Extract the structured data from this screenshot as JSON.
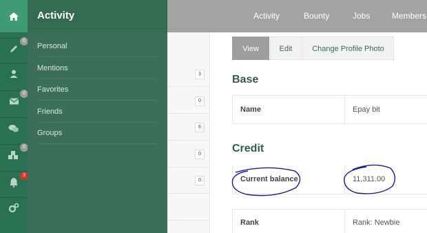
{
  "top_nav": {
    "items": [
      "Activity",
      "Bounty",
      "Jobs",
      "Members"
    ]
  },
  "rail": {
    "items": [
      {
        "icon": "home-icon"
      },
      {
        "icon": "pencil-icon",
        "badge": "0"
      },
      {
        "icon": "user-icon"
      },
      {
        "icon": "envelope-icon",
        "badge": "0"
      },
      {
        "icon": "comments-icon"
      },
      {
        "icon": "cubes-icon",
        "badge": "0"
      },
      {
        "icon": "bell-icon",
        "badge": "3"
      },
      {
        "icon": "gears-icon"
      }
    ]
  },
  "flyout": {
    "title": "Activity",
    "items": [
      "Personal",
      "Mentions",
      "Favorites",
      "Friends",
      "Groups"
    ]
  },
  "list_counts": [
    "3",
    "0",
    "6",
    "0",
    "0"
  ],
  "tabs": [
    "View",
    "Edit",
    "Change Profile Photo"
  ],
  "sections": {
    "base": {
      "title": "Base",
      "rows": [
        {
          "label": "Name",
          "value": "Epay bit"
        }
      ]
    },
    "credit": {
      "title": "Credit",
      "rows": [
        {
          "label": "Current balance",
          "value": "11,311.00"
        }
      ]
    },
    "rank": {
      "label": "Rank",
      "value": "Rank: Newbie"
    }
  },
  "colors": {
    "rail": "#2a7154",
    "flyout": "#3c6f5b",
    "accent_green": "#2f5f4a",
    "topbar": "#a3a3a3",
    "annotation_ink": "#1a1aa8"
  }
}
